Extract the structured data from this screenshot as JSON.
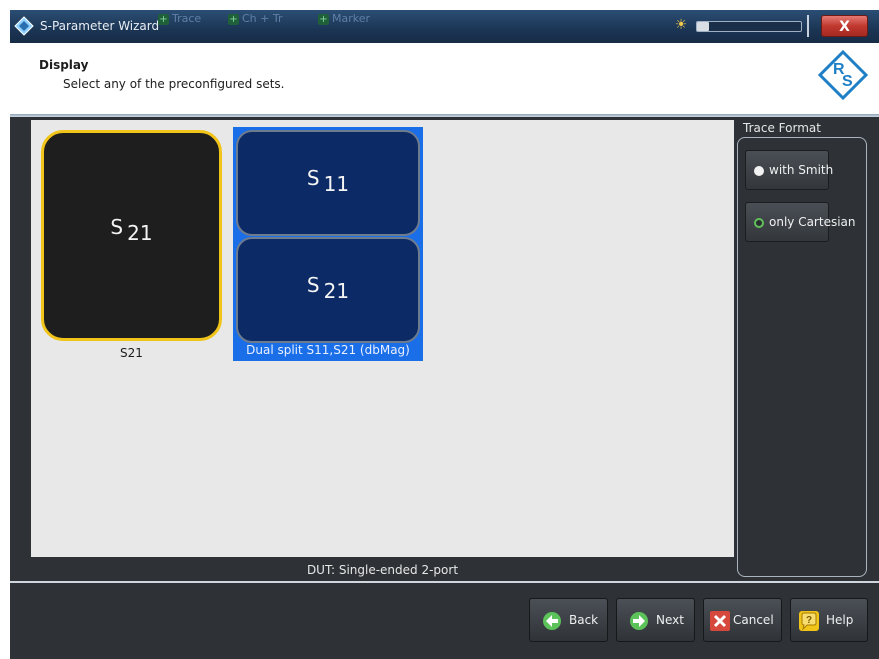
{
  "window": {
    "title": "S-Parameter Wizard",
    "background_toolbar": [
      "Trace",
      "Ch + Tr",
      "Marker"
    ],
    "close_label": "X"
  },
  "header": {
    "title": "Display",
    "subtitle": "Select any of the preconfigured sets.",
    "logo_text": "RS"
  },
  "main": {
    "presets": [
      {
        "label": "S21",
        "traces": [
          {
            "s": "S",
            "port": "21"
          }
        ],
        "selected": false
      },
      {
        "label": "Dual split S11,S21 (dbMag)",
        "traces": [
          {
            "s": "S",
            "port": "11"
          },
          {
            "s": "S",
            "port": "21"
          }
        ],
        "selected": true
      }
    ],
    "dut_label": "DUT: Single-ended 2-port"
  },
  "trace_format": {
    "title": "Trace Format",
    "options": [
      {
        "label": "with Smith",
        "selected": false
      },
      {
        "label": "only Cartesian",
        "selected": true
      }
    ]
  },
  "footer": {
    "back_label": "Back",
    "next_label": "Next",
    "cancel_label": "Cancel",
    "help_label": "Help"
  },
  "colors": {
    "accent_selected_border": "#f0c419",
    "selection_highlight": "#1a6ee8",
    "trace_tile_bg": "#0c2a66"
  },
  "icons": {
    "app": "rs-diamond-icon",
    "brightness": "sun-icon",
    "back": "arrow-left-circle-icon",
    "next": "arrow-right-circle-icon",
    "cancel": "x-icon",
    "help": "question-bubble-icon"
  }
}
